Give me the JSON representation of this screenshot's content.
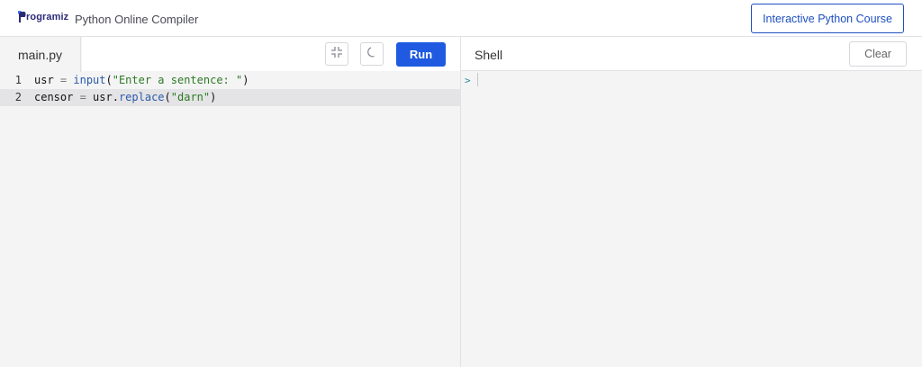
{
  "header": {
    "logo_text": "rogramiz",
    "app_title": "Python Online Compiler",
    "course_button": "Interactive Python Course"
  },
  "editor": {
    "file_name": "main.py",
    "run_label": "Run",
    "lines": [
      {
        "number": "1",
        "tokens": [
          "usr",
          " = ",
          "input",
          "(",
          "\"Enter a sentence: \"",
          ")"
        ]
      },
      {
        "number": "2",
        "tokens": [
          "censor",
          " = ",
          "usr.",
          "replace",
          "(",
          "\"darn\"",
          ")"
        ]
      }
    ],
    "active_line": 2
  },
  "shell": {
    "title": "Shell",
    "clear_label": "Clear",
    "prompt": ">"
  },
  "colors": {
    "brand_blue": "#1f5ae0",
    "link_blue": "#1e4fbf",
    "logo_navy": "#2b2a78",
    "string_green": "#2c7a22",
    "function_blue": "#2a5aa8"
  },
  "icons": [
    "programiz-logo-icon",
    "collapse-icon",
    "moon-icon"
  ]
}
